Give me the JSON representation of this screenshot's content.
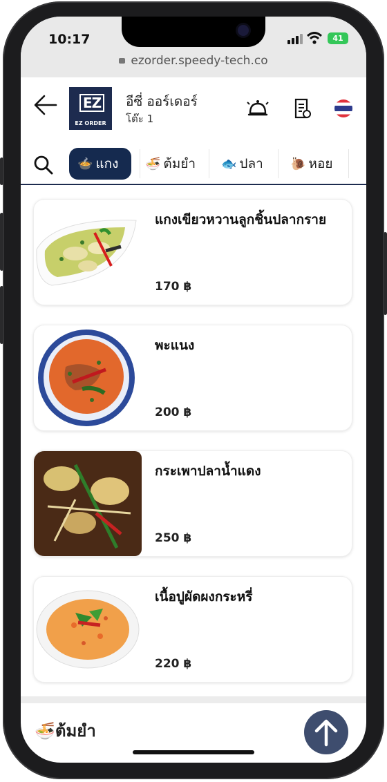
{
  "status_bar": {
    "time": "10:17",
    "battery": "41"
  },
  "browser": {
    "url": "ezorder.speedy-tech.co"
  },
  "header": {
    "logo_text": "EZ ORDER",
    "shop_name": "อีซี่ ออร์เดอร์",
    "table_label": "โต๊ะ 1",
    "icons": [
      "back-arrow-icon",
      "service-bell-icon",
      "order-list-icon",
      "thai-flag-icon"
    ]
  },
  "categories": [
    {
      "label": "แกง",
      "emoji": "🍲",
      "active": true
    },
    {
      "label": "ต้มยำ",
      "emoji": "🍜",
      "active": false
    },
    {
      "label": "ปลา",
      "emoji": "🐟",
      "active": false
    },
    {
      "label": "หอย",
      "emoji": "🐌",
      "active": false
    }
  ],
  "menu": [
    {
      "name": "แกงเขียวหวานลูกชิ้นปลากราย",
      "price": "170 ฿"
    },
    {
      "name": "พะแนง",
      "price": "200 ฿"
    },
    {
      "name": "กระเพาปลาน้ำแดง",
      "price": "250 ฿"
    },
    {
      "name": "เนื้อปูผัดผงกระหรี่",
      "price": "220 ฿"
    }
  ],
  "next_section": {
    "label": "ต้มยำ",
    "emoji": "🍜"
  },
  "colors": {
    "primary": "#152a4f",
    "fab": "#3e4d6e"
  }
}
